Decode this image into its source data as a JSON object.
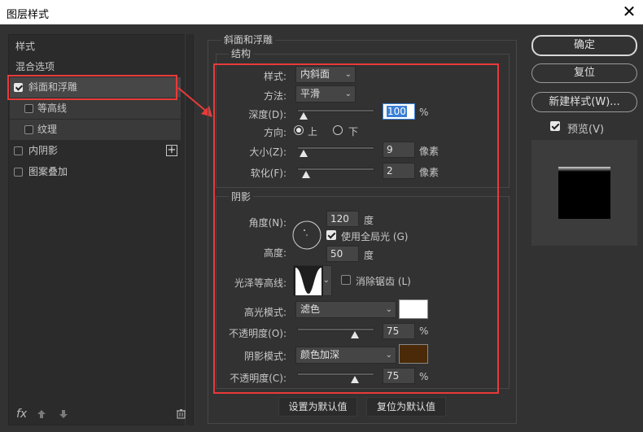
{
  "window": {
    "title": "图层样式",
    "close_icon": "close-icon"
  },
  "left_panel": {
    "items": [
      {
        "label": "样式",
        "has_check": false,
        "checked": false
      },
      {
        "label": "混合选项",
        "has_check": false,
        "checked": false
      },
      {
        "label": "斜面和浮雕",
        "has_check": true,
        "checked": true
      },
      {
        "label": "等高线",
        "has_check": true,
        "checked": false
      },
      {
        "label": "纹理",
        "has_check": true,
        "checked": false
      },
      {
        "label": "内阴影",
        "has_check": true,
        "checked": false
      },
      {
        "label": "图案叠加",
        "has_check": true,
        "checked": false
      }
    ],
    "bottom_icons": [
      "fx-icon",
      "arrow-up-icon",
      "arrow-down-icon",
      "trash-icon"
    ],
    "fx_label": "fx"
  },
  "bevel": {
    "section_title": "斜面和浮雕",
    "structure": {
      "title": "结构",
      "style_label": "样式:",
      "style_value": "内斜面",
      "technique_label": "方法:",
      "technique_value": "平滑",
      "depth_label": "深度(D):",
      "depth_value": "100",
      "depth_unit": "%",
      "direction_label": "方向:",
      "direction_up": "上",
      "direction_down": "下",
      "size_label": "大小(Z):",
      "size_value": "9",
      "size_unit": "像素",
      "soften_label": "软化(F):",
      "soften_value": "2",
      "soften_unit": "像素"
    },
    "shading": {
      "title": "阴影",
      "angle_label": "角度(N):",
      "angle_value": "120",
      "angle_unit": "度",
      "global_light_label": "使用全局光 (G)",
      "altitude_label": "高度:",
      "altitude_value": "50",
      "altitude_unit": "度",
      "gloss_contour_label": "光泽等高线:",
      "anti_alias_label": "消除锯齿 (L)",
      "highlight_mode_label": "高光模式:",
      "highlight_mode_value": "滤色",
      "highlight_color": "#ffffff",
      "highlight_opacity_label": "不透明度(O):",
      "highlight_opacity_value": "75",
      "highlight_opacity_unit": "%",
      "shadow_mode_label": "阴影模式:",
      "shadow_mode_value": "颜色加深",
      "shadow_color": "#4a2a08",
      "shadow_opacity_label": "不透明度(C):",
      "shadow_opacity_value": "75",
      "shadow_opacity_unit": "%"
    },
    "set_default": "设置为默认值",
    "reset_default": "复位为默认值"
  },
  "right": {
    "ok": "确定",
    "reset": "复位",
    "new_style": "新建样式(W)...",
    "preview_label": "预览(V)"
  },
  "annotation_color": "#e83a3a"
}
